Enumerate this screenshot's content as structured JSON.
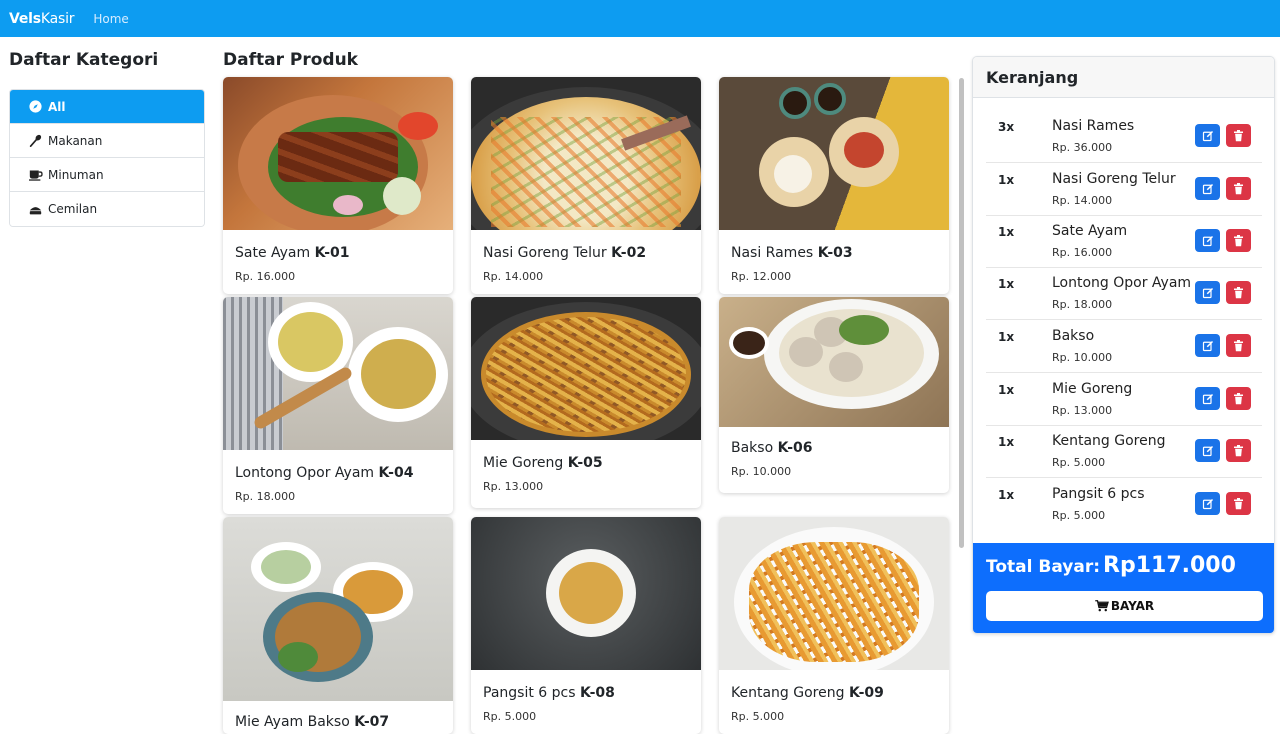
{
  "navbar": {
    "brand_bold": "Vels",
    "brand_rest": "Kasir",
    "home": "Home"
  },
  "categories": {
    "title": "Daftar Kategori",
    "items": [
      {
        "label": "All",
        "icon": "compass-icon",
        "active": true
      },
      {
        "label": "Makanan",
        "icon": "utensil-icon",
        "active": false
      },
      {
        "label": "Minuman",
        "icon": "coffee-icon",
        "active": false
      },
      {
        "label": "Cemilan",
        "icon": "cake-icon",
        "active": false
      }
    ]
  },
  "products": {
    "title": "Daftar Produk",
    "items": [
      {
        "name": "Sate Ayam",
        "code": "K-01",
        "price": "Rp. 16.000"
      },
      {
        "name": "Nasi Goreng Telur",
        "code": "K-02",
        "price": "Rp. 14.000"
      },
      {
        "name": "Nasi Rames",
        "code": "K-03",
        "price": "Rp. 12.000"
      },
      {
        "name": "Lontong Opor Ayam",
        "code": "K-04",
        "price": "Rp. 18.000"
      },
      {
        "name": "Mie Goreng",
        "code": "K-05",
        "price": "Rp. 13.000"
      },
      {
        "name": "Bakso",
        "code": "K-06",
        "price": "Rp. 10.000"
      },
      {
        "name": "Mie Ayam Bakso",
        "code": "K-07",
        "price": ""
      },
      {
        "name": "Pangsit 6 pcs",
        "code": "K-08",
        "price": "Rp. 5.000"
      },
      {
        "name": "Kentang Goreng",
        "code": "K-09",
        "price": "Rp. 5.000"
      }
    ]
  },
  "cart": {
    "title": "Keranjang",
    "items": [
      {
        "qty": "3x",
        "name": "Nasi Rames",
        "price": "Rp. 36.000"
      },
      {
        "qty": "1x",
        "name": "Nasi Goreng Telur",
        "price": "Rp. 14.000"
      },
      {
        "qty": "1x",
        "name": "Sate Ayam",
        "price": "Rp. 16.000"
      },
      {
        "qty": "1x",
        "name": "Lontong Opor Ayam",
        "price": "Rp. 18.000"
      },
      {
        "qty": "1x",
        "name": "Bakso",
        "price": "Rp. 10.000"
      },
      {
        "qty": "1x",
        "name": "Mie Goreng",
        "price": "Rp. 13.000"
      },
      {
        "qty": "1x",
        "name": "Kentang Goreng",
        "price": "Rp. 5.000"
      },
      {
        "qty": "1x",
        "name": "Pangsit 6 pcs",
        "price": "Rp. 5.000"
      }
    ],
    "total_label": "Total Bayar:",
    "total_value": "Rp117.000",
    "pay_label": "BAYAR"
  },
  "colors": {
    "navbar": "#0d9cf1",
    "active_category": "#0d9cf1",
    "cart_footer": "#0d6efd",
    "edit_button": "#1a73e8",
    "delete_button": "#dc3545"
  }
}
